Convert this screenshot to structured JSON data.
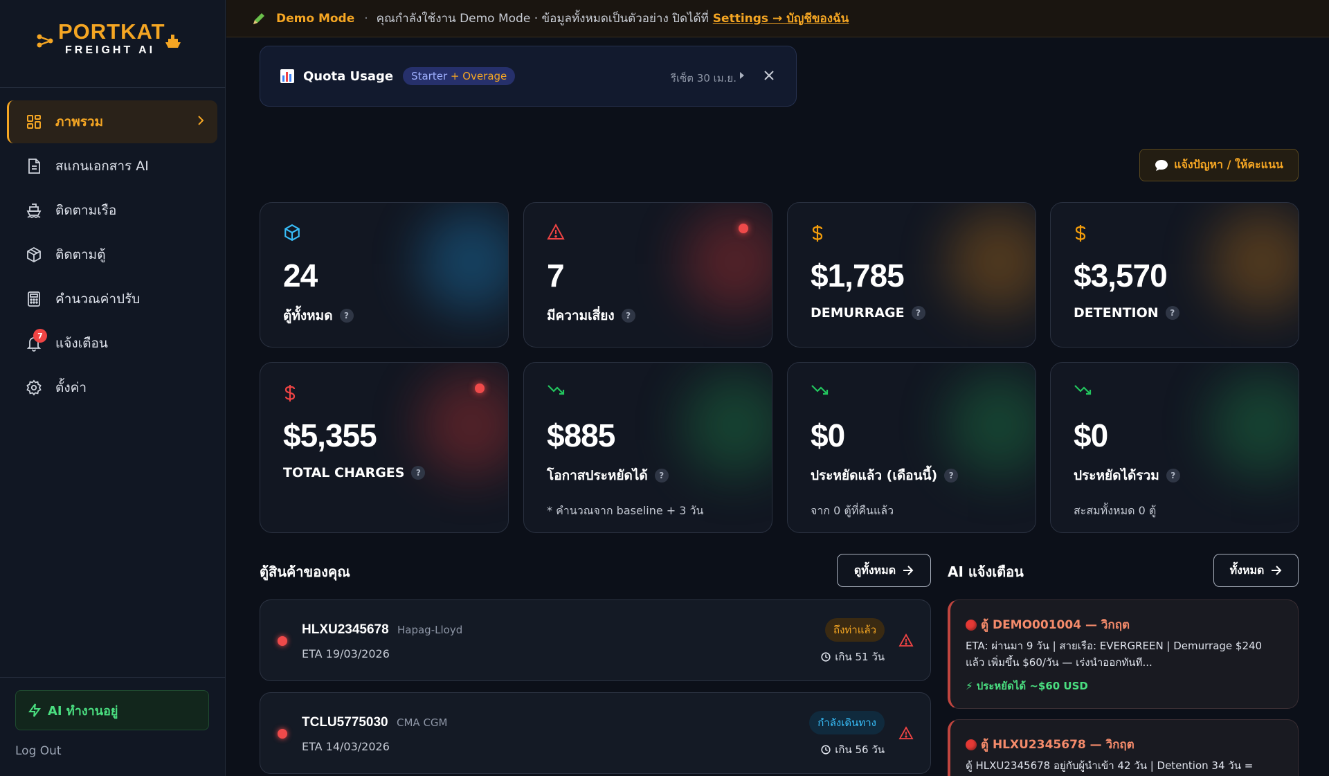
{
  "brand": {
    "name": "PORTKAT",
    "sub": "FREIGHT AI"
  },
  "sidebar": {
    "items": [
      {
        "label": "ภาพรวม",
        "icon": "grid-icon",
        "active": true
      },
      {
        "label": "สแกนเอกสาร AI",
        "icon": "document-icon"
      },
      {
        "label": "ติดตามเรือ",
        "icon": "ship-icon"
      },
      {
        "label": "ติดตามตู้",
        "icon": "box-icon"
      },
      {
        "label": "คำนวณค่าปรับ",
        "icon": "calculator-icon"
      },
      {
        "label": "แจ้งเตือน",
        "icon": "bell-icon",
        "badge": "7"
      },
      {
        "label": "ตั้งค่า",
        "icon": "gear-icon"
      }
    ],
    "ai_status": "AI ทำงานอยู่",
    "logout": "Log Out"
  },
  "topbar": {
    "mode": "Demo Mode",
    "separator": "·",
    "text": "คุณกำลังใช้งาน Demo Mode · ข้อมูลทั้งหมดเป็นตัวอย่าง ปิดได้ที่",
    "link": "Settings → บัญชีของฉัน"
  },
  "quota": {
    "title": "Quota Usage",
    "plan": "Starter",
    "overage": "+ Overage",
    "reset": "รีเซ็ต 30 เม.ย."
  },
  "feedback": "แจ้งปัญหา / ให้คะแนน",
  "stats": [
    {
      "value": "24",
      "label": "ตู้ทั้งหมด",
      "icon": "cube-icon",
      "color": "#38bdf8"
    },
    {
      "value": "7",
      "label": "มีความเสี่ยง",
      "icon": "warning-icon",
      "color": "#ef4444"
    },
    {
      "value": "$1,785",
      "label": "DEMURRAGE",
      "icon": "dollar-icon",
      "color": "#f59e0b"
    },
    {
      "value": "$3,570",
      "label": "DETENTION",
      "icon": "dollar-icon",
      "color": "#f59e0b"
    },
    {
      "value": "$5,355",
      "label": "TOTAL CHARGES",
      "icon": "dollar-icon",
      "color": "#ef4444"
    },
    {
      "value": "$885",
      "label": "โอกาสประหยัดได้",
      "sub": "* คำนวณจาก baseline + 3 วัน",
      "icon": "trend-down-icon",
      "color": "#22c55e"
    },
    {
      "value": "$0",
      "label": "ประหยัดแล้ว (เดือนนี้)",
      "sub": "จาก 0 ตู้ที่คืนแล้ว",
      "icon": "trend-down-icon",
      "color": "#22c55e"
    },
    {
      "value": "$0",
      "label": "ประหยัดได้รวม",
      "sub": "สะสมทั้งหมด 0 ตู้",
      "icon": "trend-down-icon",
      "color": "#22c55e"
    }
  ],
  "containers": {
    "title": "ตู้สินค้าของคุณ",
    "button": "ดูทั้งหมด",
    "rows": [
      {
        "id": "HLXU2345678",
        "carrier": "Hapag-Lloyd",
        "eta": "ETA 19/03/2026",
        "status": "ถึงท่าแล้ว",
        "over": "เกิน 51 วัน"
      },
      {
        "id": "TCLU5775030",
        "carrier": "CMA CGM",
        "eta": "ETA 14/03/2026",
        "status": "กำลังเดินทาง",
        "over": "เกิน 56 วัน"
      }
    ]
  },
  "alerts": {
    "title": "AI แจ้งเตือน",
    "button": "ทั้งหมด",
    "items": [
      {
        "title": "ตู้ DEMO001004 — วิกฤต",
        "body": "ETA: ผ่านมา 9 วัน | สายเรือ: EVERGREEN | Demurrage $240 แล้ว เพิ่มขึ้น $60/วัน — เร่งนำออกทันที...",
        "save": "⚡ ประหยัดได้ ~$60 USD"
      },
      {
        "title": "ตู้ HLXU2345678 — วิกฤต",
        "body": "ตู้ HLXU2345678 อยู่กับผู้นำเข้า 42 วัน | Detention 34 วัน ="
      }
    ]
  }
}
